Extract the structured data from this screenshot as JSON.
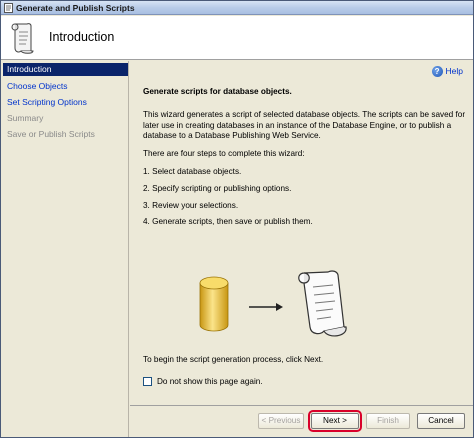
{
  "window": {
    "title": "Generate and Publish Scripts"
  },
  "header": {
    "title": "Introduction"
  },
  "sidebar": {
    "items": [
      {
        "label": "Introduction",
        "state": "active"
      },
      {
        "label": "Choose Objects",
        "state": "link"
      },
      {
        "label": "Set Scripting Options",
        "state": "link"
      },
      {
        "label": "Summary",
        "state": "disabled"
      },
      {
        "label": "Save or Publish Scripts",
        "state": "disabled"
      }
    ]
  },
  "help": {
    "label": "Help",
    "icon": "help-icon"
  },
  "main": {
    "heading": "Generate scripts for database objects.",
    "description": "This wizard generates a script of selected database objects. The scripts can be saved for later use in creating databases in an instance of the Database Engine, or to publish a database to a Database Publishing Web Service.",
    "steps_intro": "There are four steps to complete this wizard:",
    "steps": [
      "1. Select database objects.",
      "2. Specify scripting or publishing options.",
      "3. Review your selections.",
      "4. Generate scripts, then save or publish them."
    ],
    "illustration_icons": [
      "database-icon",
      "arrow-icon",
      "script-scroll-icon"
    ],
    "begin_text": "To begin the script generation process, click Next.",
    "checkbox_label": "Do not show this page again.",
    "checkbox_checked": false
  },
  "buttons": {
    "previous": "< Previous",
    "next": "Next >",
    "finish": "Finish",
    "cancel": "Cancel"
  },
  "colors": {
    "active_nav": "#0a246a",
    "link": "#0033cc",
    "highlight": "#d9002a",
    "database": "#f2c230"
  }
}
